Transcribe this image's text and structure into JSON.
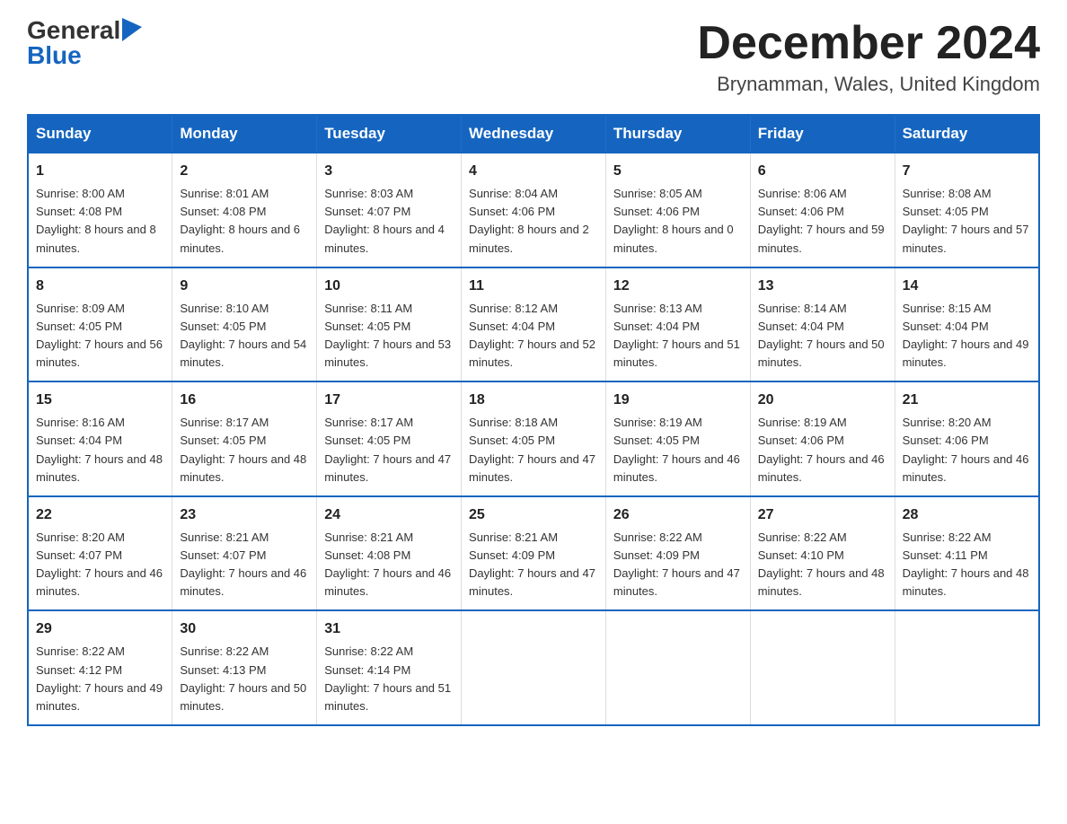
{
  "header": {
    "logo": {
      "general": "General",
      "blue": "Blue",
      "triangle": "▶"
    },
    "title": "December 2024",
    "location": "Brynamman, Wales, United Kingdom"
  },
  "calendar": {
    "days_of_week": [
      "Sunday",
      "Monday",
      "Tuesday",
      "Wednesday",
      "Thursday",
      "Friday",
      "Saturday"
    ],
    "weeks": [
      [
        {
          "day": "1",
          "sunrise": "8:00 AM",
          "sunset": "4:08 PM",
          "daylight": "8 hours and 8 minutes."
        },
        {
          "day": "2",
          "sunrise": "8:01 AM",
          "sunset": "4:08 PM",
          "daylight": "8 hours and 6 minutes."
        },
        {
          "day": "3",
          "sunrise": "8:03 AM",
          "sunset": "4:07 PM",
          "daylight": "8 hours and 4 minutes."
        },
        {
          "day": "4",
          "sunrise": "8:04 AM",
          "sunset": "4:06 PM",
          "daylight": "8 hours and 2 minutes."
        },
        {
          "day": "5",
          "sunrise": "8:05 AM",
          "sunset": "4:06 PM",
          "daylight": "8 hours and 0 minutes."
        },
        {
          "day": "6",
          "sunrise": "8:06 AM",
          "sunset": "4:06 PM",
          "daylight": "7 hours and 59 minutes."
        },
        {
          "day": "7",
          "sunrise": "8:08 AM",
          "sunset": "4:05 PM",
          "daylight": "7 hours and 57 minutes."
        }
      ],
      [
        {
          "day": "8",
          "sunrise": "8:09 AM",
          "sunset": "4:05 PM",
          "daylight": "7 hours and 56 minutes."
        },
        {
          "day": "9",
          "sunrise": "8:10 AM",
          "sunset": "4:05 PM",
          "daylight": "7 hours and 54 minutes."
        },
        {
          "day": "10",
          "sunrise": "8:11 AM",
          "sunset": "4:05 PM",
          "daylight": "7 hours and 53 minutes."
        },
        {
          "day": "11",
          "sunrise": "8:12 AM",
          "sunset": "4:04 PM",
          "daylight": "7 hours and 52 minutes."
        },
        {
          "day": "12",
          "sunrise": "8:13 AM",
          "sunset": "4:04 PM",
          "daylight": "7 hours and 51 minutes."
        },
        {
          "day": "13",
          "sunrise": "8:14 AM",
          "sunset": "4:04 PM",
          "daylight": "7 hours and 50 minutes."
        },
        {
          "day": "14",
          "sunrise": "8:15 AM",
          "sunset": "4:04 PM",
          "daylight": "7 hours and 49 minutes."
        }
      ],
      [
        {
          "day": "15",
          "sunrise": "8:16 AM",
          "sunset": "4:04 PM",
          "daylight": "7 hours and 48 minutes."
        },
        {
          "day": "16",
          "sunrise": "8:17 AM",
          "sunset": "4:05 PM",
          "daylight": "7 hours and 48 minutes."
        },
        {
          "day": "17",
          "sunrise": "8:17 AM",
          "sunset": "4:05 PM",
          "daylight": "7 hours and 47 minutes."
        },
        {
          "day": "18",
          "sunrise": "8:18 AM",
          "sunset": "4:05 PM",
          "daylight": "7 hours and 47 minutes."
        },
        {
          "day": "19",
          "sunrise": "8:19 AM",
          "sunset": "4:05 PM",
          "daylight": "7 hours and 46 minutes."
        },
        {
          "day": "20",
          "sunrise": "8:19 AM",
          "sunset": "4:06 PM",
          "daylight": "7 hours and 46 minutes."
        },
        {
          "day": "21",
          "sunrise": "8:20 AM",
          "sunset": "4:06 PM",
          "daylight": "7 hours and 46 minutes."
        }
      ],
      [
        {
          "day": "22",
          "sunrise": "8:20 AM",
          "sunset": "4:07 PM",
          "daylight": "7 hours and 46 minutes."
        },
        {
          "day": "23",
          "sunrise": "8:21 AM",
          "sunset": "4:07 PM",
          "daylight": "7 hours and 46 minutes."
        },
        {
          "day": "24",
          "sunrise": "8:21 AM",
          "sunset": "4:08 PM",
          "daylight": "7 hours and 46 minutes."
        },
        {
          "day": "25",
          "sunrise": "8:21 AM",
          "sunset": "4:09 PM",
          "daylight": "7 hours and 47 minutes."
        },
        {
          "day": "26",
          "sunrise": "8:22 AM",
          "sunset": "4:09 PM",
          "daylight": "7 hours and 47 minutes."
        },
        {
          "day": "27",
          "sunrise": "8:22 AM",
          "sunset": "4:10 PM",
          "daylight": "7 hours and 48 minutes."
        },
        {
          "day": "28",
          "sunrise": "8:22 AM",
          "sunset": "4:11 PM",
          "daylight": "7 hours and 48 minutes."
        }
      ],
      [
        {
          "day": "29",
          "sunrise": "8:22 AM",
          "sunset": "4:12 PM",
          "daylight": "7 hours and 49 minutes."
        },
        {
          "day": "30",
          "sunrise": "8:22 AM",
          "sunset": "4:13 PM",
          "daylight": "7 hours and 50 minutes."
        },
        {
          "day": "31",
          "sunrise": "8:22 AM",
          "sunset": "4:14 PM",
          "daylight": "7 hours and 51 minutes."
        },
        null,
        null,
        null,
        null
      ]
    ]
  }
}
